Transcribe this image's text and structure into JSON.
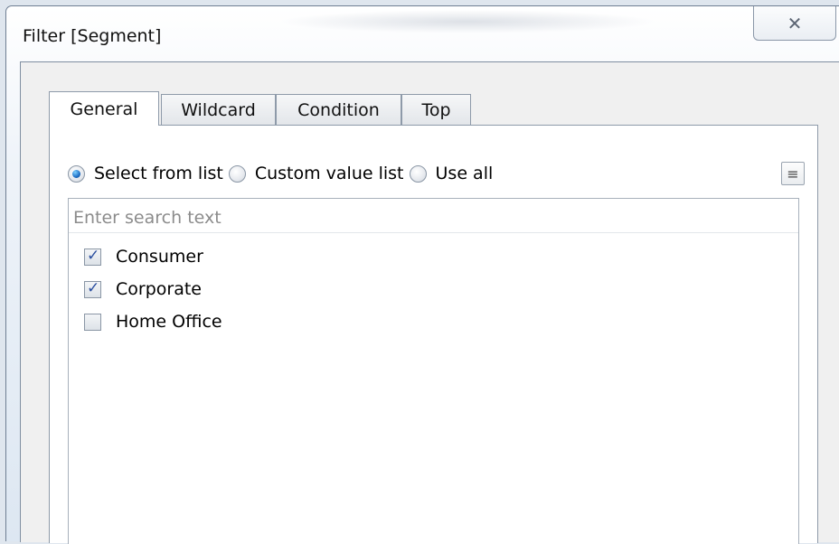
{
  "window": {
    "title": "Filter [Segment]",
    "close_glyph": "✕"
  },
  "tabs": [
    {
      "label": "General"
    },
    {
      "label": "Wildcard"
    },
    {
      "label": "Condition"
    },
    {
      "label": "Top"
    }
  ],
  "selection_mode": {
    "options": [
      {
        "label": "Select from list",
        "selected": true
      },
      {
        "label": "Custom value list",
        "selected": false
      },
      {
        "label": "Use all",
        "selected": false
      }
    ]
  },
  "menu_button_glyph": "≡",
  "list": {
    "search_placeholder": "Enter search text",
    "items": [
      {
        "label": "Consumer",
        "checked": true
      },
      {
        "label": "Corporate",
        "checked": true
      },
      {
        "label": "Home Office",
        "checked": false
      }
    ]
  }
}
